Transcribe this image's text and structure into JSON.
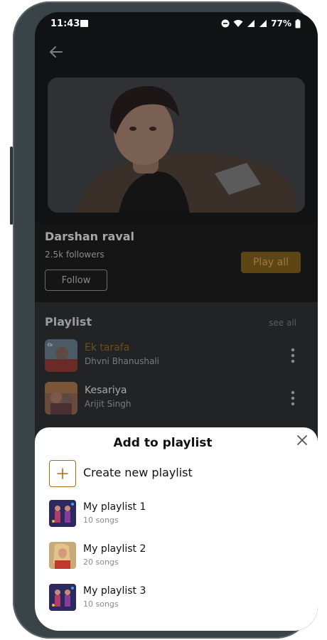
{
  "status": {
    "time": "11:43",
    "battery": "77%"
  },
  "artist": {
    "name": "Darshan raval",
    "followers": "2.5k followers",
    "follow_label": "Follow",
    "play_all_label": "Play all"
  },
  "playlist_section": {
    "title": "Playlist",
    "see_all": "see all",
    "songs": [
      {
        "title": "Ek tarafa",
        "artist": "Dhvni Bhanushali",
        "active": true
      },
      {
        "title": "Kesariya",
        "artist": "Arijit Singh",
        "active": false
      }
    ]
  },
  "sheet": {
    "title": "Add to playlist",
    "create_label": "Create new playlist",
    "playlists": [
      {
        "name": "My playlist 1",
        "count": "10 songs"
      },
      {
        "name": "My playlist 2",
        "count": "20 songs"
      },
      {
        "name": "My playlist 3",
        "count": "10 songs"
      }
    ]
  },
  "colors": {
    "accent": "#a56e12",
    "active_song": "#6b4f1b",
    "dim_text": "#a7a7a7"
  },
  "icons": {
    "back": "arrow-left-icon",
    "close": "close-icon",
    "plus": "plus-icon",
    "more": "more-vertical-icon"
  }
}
